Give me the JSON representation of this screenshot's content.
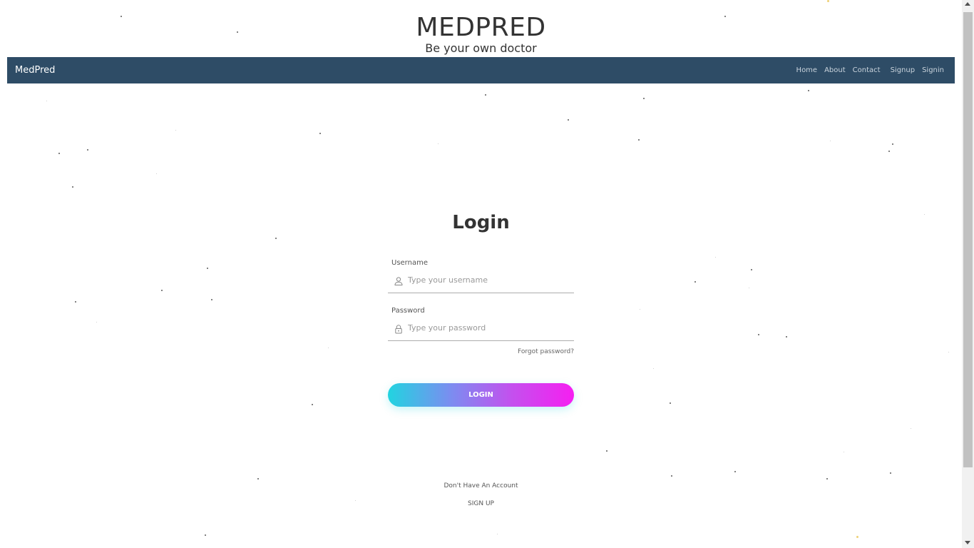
{
  "header": {
    "title": "MEDPRED",
    "tagline": "Be your own doctor"
  },
  "navbar": {
    "brand": "MedPred",
    "links": [
      "Home",
      "About",
      "Contact",
      "Signup",
      "Signin"
    ],
    "background": "#2e4c66"
  },
  "login": {
    "title": "Login",
    "username": {
      "label": "Username",
      "placeholder": "Type your username",
      "icon": "user-icon"
    },
    "password": {
      "label": "Password",
      "placeholder": "Type your password",
      "icon": "lock-icon"
    },
    "forgot_label": "Forgot password?",
    "button_label": "LOGIN",
    "button_gradient": [
      "#21d4e0",
      "#f61ff1"
    ]
  },
  "signup": {
    "prompt": "Don't Have An Account",
    "link": "SIGN UP"
  }
}
